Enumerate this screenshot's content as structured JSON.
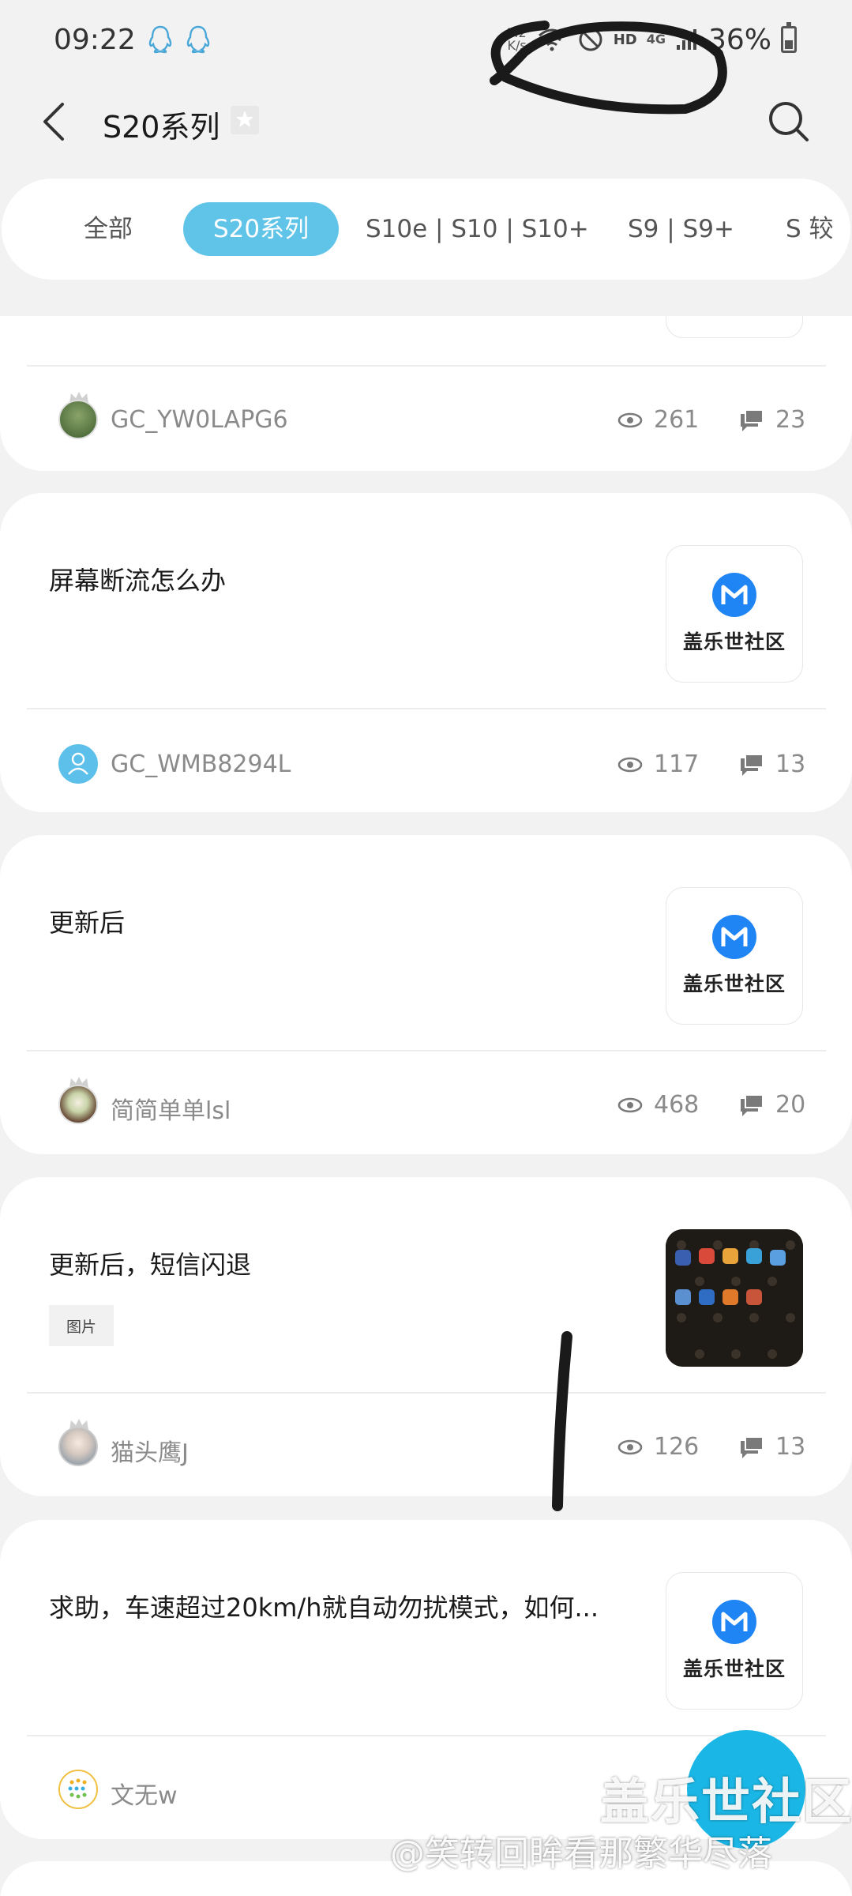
{
  "status_bar": {
    "time": "09:22",
    "net_speed": "1.2",
    "net_unit": "K/s",
    "hd": "HD",
    "signal": "4G",
    "battery": "36%"
  },
  "header": {
    "title": "S20系列"
  },
  "tabs": [
    {
      "label": "全部"
    },
    {
      "label": "S20系列"
    },
    {
      "label": "S10e | S10 | S10+"
    },
    {
      "label": "S9 | S9+"
    },
    {
      "label": "S 较"
    }
  ],
  "posts": [
    {
      "title": "",
      "author": "GC_YW0LAPG6",
      "views": "261",
      "comments": "23"
    },
    {
      "title": "屏幕断流怎么办",
      "thumb_text": "盖乐世社区",
      "author": "GC_WMB8294L",
      "views": "117",
      "comments": "13"
    },
    {
      "title": "更新后",
      "thumb_text": "盖乐世社区",
      "author": "简简单单lsl",
      "views": "468",
      "comments": "20"
    },
    {
      "title": "更新后，短信闪退",
      "tag": "图片",
      "author": "猫头鹰J",
      "views": "126",
      "comments": "13"
    },
    {
      "title": "求助，车速超过20km/h就自动勿扰模式，如何...",
      "thumb_text": "盖乐世社区",
      "author": "文无w"
    }
  ],
  "watermark": {
    "title": "盖乐世社区",
    "subtitle": "@笑转回眸看那繁华尽落"
  },
  "colors": {
    "accent": "#5fc4e8",
    "logo_blue": "#1f84f4",
    "fab": "#1ab7e6"
  }
}
